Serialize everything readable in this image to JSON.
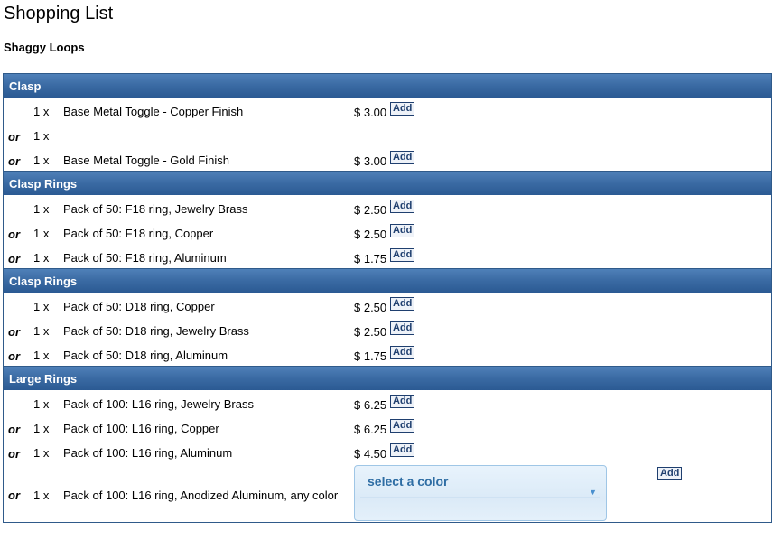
{
  "page": {
    "title": "Shopping List",
    "subtitle": "Shaggy Loops"
  },
  "labels": {
    "or": "or",
    "add": "Add"
  },
  "sections": [
    {
      "title": "Clasp",
      "rows": [
        {
          "or": "",
          "qty": "1 x",
          "desc": "Base Metal Toggle - Copper Finish",
          "price": "$ 3.00",
          "add": "Add"
        },
        {
          "or": "or",
          "qty": "1 x",
          "desc": "",
          "price": "",
          "add": ""
        },
        {
          "or": "or",
          "qty": "1 x",
          "desc": "Base Metal Toggle - Gold Finish",
          "price": "$ 3.00",
          "add": "Add"
        }
      ]
    },
    {
      "title": "Clasp Rings",
      "rows": [
        {
          "or": "",
          "qty": "1 x",
          "desc": "Pack of 50: F18 ring, Jewelry Brass",
          "price": "$ 2.50",
          "add": "Add"
        },
        {
          "or": "or",
          "qty": "1 x",
          "desc": "Pack of 50: F18 ring, Copper",
          "price": "$ 2.50",
          "add": "Add"
        },
        {
          "or": "or",
          "qty": "1 x",
          "desc": "Pack of 50: F18 ring, Aluminum",
          "price": "$ 1.75",
          "add": "Add"
        }
      ]
    },
    {
      "title": "Clasp Rings",
      "rows": [
        {
          "or": "",
          "qty": "1 x",
          "desc": "Pack of 50: D18 ring, Copper",
          "price": "$ 2.50",
          "add": "Add"
        },
        {
          "or": "or",
          "qty": "1 x",
          "desc": "Pack of 50: D18 ring, Jewelry Brass",
          "price": "$ 2.50",
          "add": "Add"
        },
        {
          "or": "or",
          "qty": "1 x",
          "desc": "Pack of 50: D18 ring, Aluminum",
          "price": "$ 1.75",
          "add": "Add"
        }
      ]
    },
    {
      "title": "Large Rings",
      "rows": [
        {
          "or": "",
          "qty": "1 x",
          "desc": "Pack of 100: L16 ring, Jewelry Brass",
          "price": "$ 6.25",
          "add": "Add"
        },
        {
          "or": "or",
          "qty": "1 x",
          "desc": "Pack of 100: L16 ring, Copper",
          "price": "$ 6.25",
          "add": "Add"
        },
        {
          "or": "or",
          "qty": "1 x",
          "desc": "Pack of 100: L16 ring, Aluminum",
          "price": "$ 4.50",
          "add": "Add"
        }
      ],
      "color_row": {
        "or": "or",
        "qty": "1 x",
        "desc": "Pack of 100: L16 ring, Anodized Aluminum, any color",
        "select_label": "select a color",
        "add": "Add"
      }
    }
  ]
}
